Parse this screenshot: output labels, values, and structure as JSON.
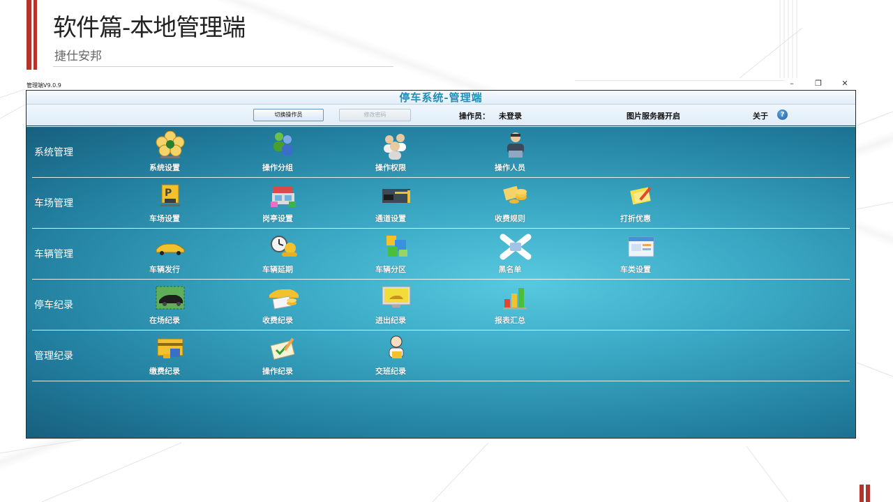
{
  "slide": {
    "title": "软件篇-本地管理端",
    "subtitle": "捷仕安邦"
  },
  "window": {
    "title": "管理端V9.0.9",
    "controls": {
      "minimize": "–",
      "restore": "❐",
      "close": "✕"
    }
  },
  "app": {
    "header_title": "停车系统-管理端",
    "toolbar": {
      "switch_operator": "切换操作员",
      "change_password": "修改密码",
      "operator_label": "操作员：",
      "operator_value": "未登录",
      "image_server": "图片服务器开启",
      "about": "关于",
      "help_glyph": "?"
    },
    "icons": {
      "system_settings": "gear-flower-icon",
      "operation_group": "group-icon",
      "operation_permission": "users-icon",
      "operation_staff": "operator-icon",
      "lot_settings": "parking-sign-icon",
      "booth_settings": "booth-icon",
      "lane_settings": "gate-icon",
      "fee_rules": "coins-icon",
      "discount": "coupon-icon",
      "vehicle_issue": "car-icon",
      "vehicle_extend": "clock-icon",
      "vehicle_zone": "map-icon",
      "blacklist": "blocked-car-icon",
      "vehicle_type": "card-icon",
      "onsite_record": "car-photo-icon",
      "fee_record": "receipt-icon",
      "inout_record": "monitor-icon",
      "report_summary": "bar-chart-icon",
      "payment_record": "payment-card-icon",
      "operation_record": "checklist-icon",
      "shift_record": "handover-icon"
    },
    "sections": [
      {
        "label": "系统管理",
        "items": [
          {
            "label": "系统设置"
          },
          {
            "label": "操作分组"
          },
          {
            "label": "操作权限"
          },
          {
            "label": "操作人员"
          }
        ]
      },
      {
        "label": "车场管理",
        "items": [
          {
            "label": "车场设置"
          },
          {
            "label": "岗亭设置"
          },
          {
            "label": "通道设置"
          },
          {
            "label": "收费规则"
          },
          {
            "label": "打折优惠"
          }
        ]
      },
      {
        "label": "车辆管理",
        "items": [
          {
            "label": "车辆发行"
          },
          {
            "label": "车辆延期"
          },
          {
            "label": "车辆分区"
          },
          {
            "label": "黑名单"
          },
          {
            "label": "车类设置"
          }
        ]
      },
      {
        "label": "停车纪录",
        "items": [
          {
            "label": "在场纪录"
          },
          {
            "label": "收费纪录"
          },
          {
            "label": "进出纪录"
          },
          {
            "label": "报表汇总"
          }
        ]
      },
      {
        "label": "管理纪录",
        "items": [
          {
            "label": "缴费纪录"
          },
          {
            "label": "操作纪录"
          },
          {
            "label": "交班纪录"
          }
        ]
      }
    ]
  }
}
